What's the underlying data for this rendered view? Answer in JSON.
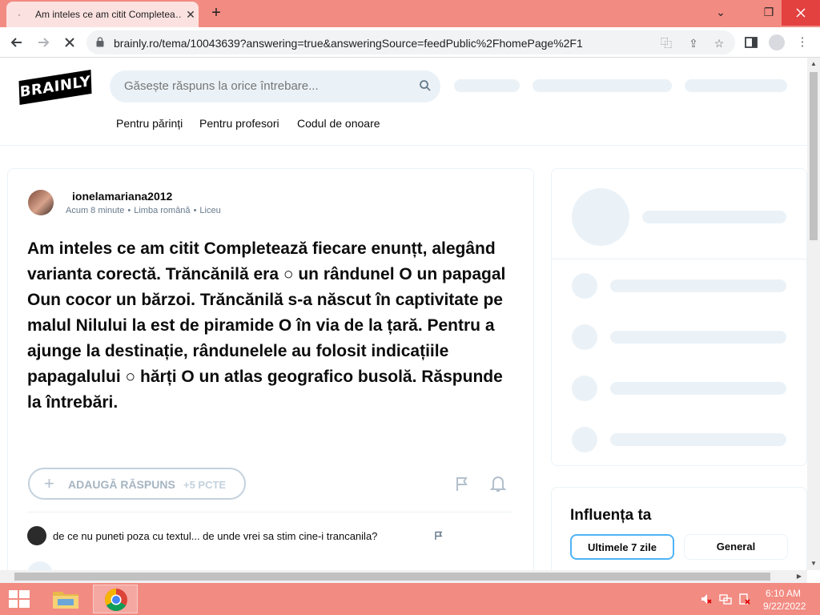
{
  "browser": {
    "tab_title": "Am inteles ce am citit Completea…",
    "tab_close": "✕",
    "new_tab": "+",
    "url": "brainly.ro/tema/10043639?answering=true&answeringSource=feedPublic%2FhomePage%2F1",
    "window_controls": {
      "minimize": "⌄",
      "restore": "❐",
      "close": "✕"
    }
  },
  "site": {
    "logo_text": "BRAINLY",
    "search_placeholder": "Găsește răspuns la orice întrebare...",
    "nav_links": [
      "Pentru părinți",
      "Pentru profesori",
      "Codul de onoare"
    ]
  },
  "question": {
    "author": "ionelamariana2012",
    "time": "Acum 8 minute",
    "subject": "Limba română",
    "level": "Liceu",
    "text": "Am inteles ce am citit Completează fiecare enunțt, alegând varianta corectă. Trăncănilă era ○ un rândunel O un papagal Oun cocor un bărzoi. Trăncănilă s-a născut în captivitate pe malul Nilului la est de piramide O în via de la țară. Pentru a ajunge la destinație, rândunelele au folosit indicațiile papagalului ○ hărți O un atlas geografico busolă. Răspunde la întrebări.",
    "answer_button": "ADAUGĂ RĂSPUNS",
    "answer_points": "+5 PCTE"
  },
  "comment": {
    "text": "de ce nu puneti poza cu textul... de unde vrei sa stim cine-i trancanila?"
  },
  "sidebar": {
    "influence_title": "Influența ta",
    "tabs": [
      "Ultimele 7 zile",
      "General"
    ],
    "active_tab": "Ultimele 7 zile"
  },
  "taskbar": {
    "time": "6:10 AM",
    "date": "9/22/2022"
  },
  "colors": {
    "tabbar": "#f28b82",
    "accent_blue": "#4fb3f6",
    "skeleton": "#ebf2f7"
  }
}
